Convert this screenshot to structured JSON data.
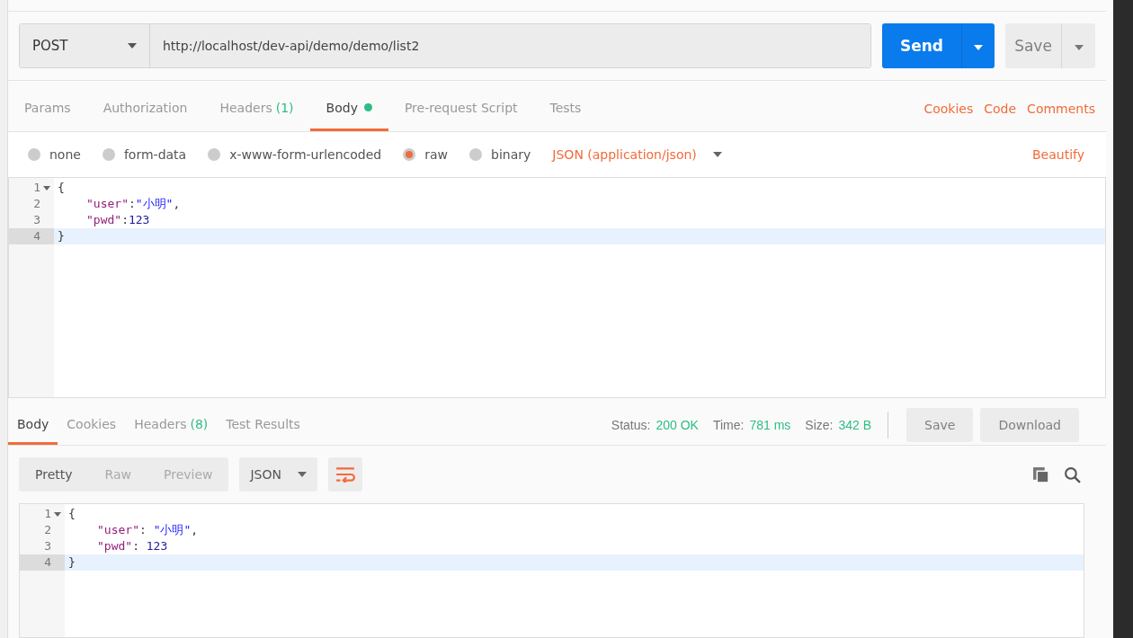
{
  "request": {
    "method": "POST",
    "url": "http://localhost/dev-api/demo/demo/list2",
    "send_label": "Send",
    "save_label": "Save"
  },
  "request_tabs": [
    {
      "label": "Params",
      "dot": false,
      "selected": false
    },
    {
      "label": "Authorization",
      "dot": false,
      "selected": false
    },
    {
      "label": "Headers",
      "count": "(1)",
      "dot": false,
      "selected": false
    },
    {
      "label": "Body",
      "dot": true,
      "selected": true
    },
    {
      "label": "Pre-request Script",
      "dot": false,
      "selected": false
    },
    {
      "label": "Tests",
      "dot": false,
      "selected": false
    }
  ],
  "request_links": [
    "Cookies",
    "Code",
    "Comments"
  ],
  "body_types": [
    {
      "label": "none",
      "selected": false
    },
    {
      "label": "form-data",
      "selected": false
    },
    {
      "label": "x-www-form-urlencoded",
      "selected": false
    },
    {
      "label": "raw",
      "selected": true
    },
    {
      "label": "binary",
      "selected": false
    }
  ],
  "content_type": "JSON (application/json)",
  "beautify": "Beautify",
  "request_body": [
    {
      "number": "1",
      "foldable": true,
      "active": false,
      "tokens": [
        {
          "kind": "punct",
          "text": "{"
        }
      ]
    },
    {
      "number": "2",
      "foldable": false,
      "active": false,
      "tokens": [
        {
          "kind": "key",
          "text": "\"user\""
        },
        {
          "kind": "punct",
          "text": ":"
        },
        {
          "kind": "string",
          "text": "\"小明\""
        },
        {
          "kind": "punct",
          "text": ","
        }
      ]
    },
    {
      "number": "3",
      "foldable": false,
      "active": false,
      "tokens": [
        {
          "kind": "key",
          "text": "\"pwd\""
        },
        {
          "kind": "punct",
          "text": ":"
        },
        {
          "kind": "number",
          "text": "123"
        }
      ]
    },
    {
      "number": "4",
      "foldable": false,
      "active": true,
      "tokens": [
        {
          "kind": "punct",
          "text": "}"
        }
      ]
    }
  ],
  "response_tabs": [
    {
      "label": "Body",
      "selected": true
    },
    {
      "label": "Cookies",
      "selected": false
    },
    {
      "label": "Headers",
      "count": "(8)",
      "selected": false
    },
    {
      "label": "Test Results",
      "selected": false
    }
  ],
  "response_stats": [
    {
      "label": "Status:",
      "value": "200 OK"
    },
    {
      "label": "Time:",
      "value": "781 ms"
    },
    {
      "label": "Size:",
      "value": "342 B"
    }
  ],
  "response_buttons": [
    "Save",
    "Download"
  ],
  "view_modes": [
    {
      "label": "Pretty",
      "selected": true
    },
    {
      "label": "Raw",
      "selected": false
    },
    {
      "label": "Preview",
      "selected": false
    }
  ],
  "format": "JSON",
  "wrap_on": true,
  "response_body": [
    {
      "number": "1",
      "foldable": true,
      "active": false,
      "tokens": [
        {
          "kind": "punct",
          "text": "{"
        }
      ]
    },
    {
      "number": "2",
      "foldable": false,
      "active": false,
      "tokens": [
        {
          "kind": "key",
          "text": "\"user\""
        },
        {
          "kind": "punct",
          "text": ": "
        },
        {
          "kind": "string",
          "text": "\"小明\""
        },
        {
          "kind": "punct",
          "text": ","
        }
      ]
    },
    {
      "number": "3",
      "foldable": false,
      "active": false,
      "tokens": [
        {
          "kind": "key",
          "text": "\"pwd\""
        },
        {
          "kind": "punct",
          "text": ": "
        },
        {
          "kind": "number",
          "text": "123"
        }
      ]
    },
    {
      "number": "4",
      "foldable": false,
      "active": true,
      "tokens": [
        {
          "kind": "punct",
          "text": "}"
        }
      ]
    }
  ]
}
